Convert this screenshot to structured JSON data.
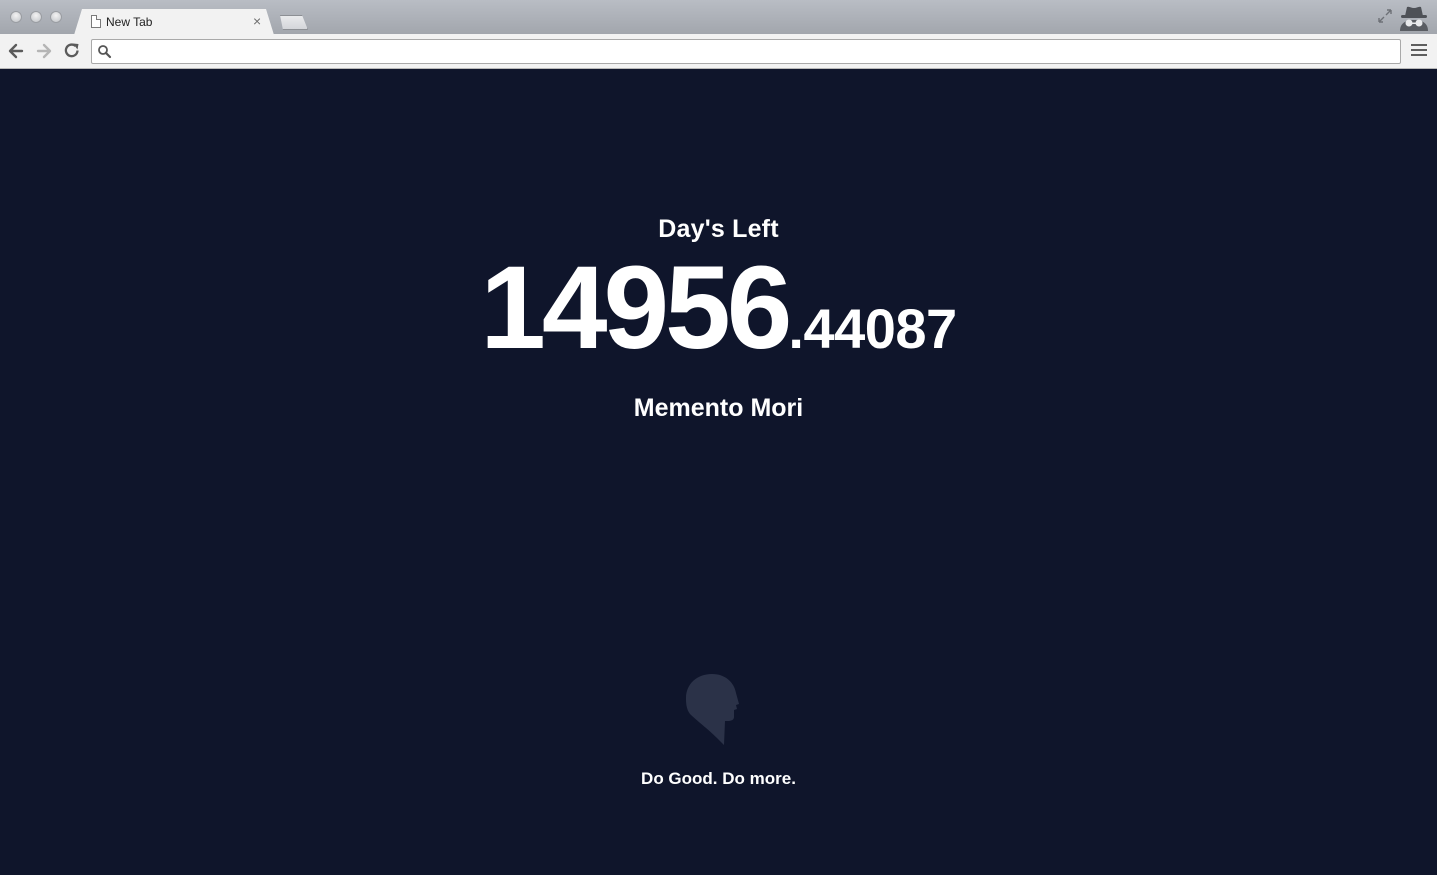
{
  "browser": {
    "tab_title": "New Tab",
    "tab_close": "×",
    "address_value": "",
    "icons": [
      "document-icon",
      "close-icon",
      "new-tab-icon",
      "fullscreen-icon",
      "incognito-icon",
      "back-arrow-icon",
      "forward-arrow-icon",
      "reload-icon",
      "search-icon",
      "menu-icon"
    ]
  },
  "page": {
    "heading": "Day's Left",
    "counter_integer": "14956",
    "counter_fraction": ".44087",
    "subheading": "Memento Mori",
    "logo_icon": "head-silhouette-icon",
    "tagline": "Do Good. Do more."
  },
  "colors": {
    "background": "#0f152b",
    "text": "#ffffff",
    "logo": "#2b3248"
  }
}
